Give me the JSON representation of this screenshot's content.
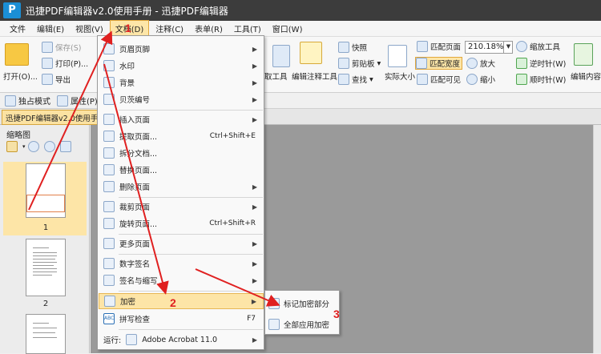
{
  "app": {
    "logo": "P",
    "title": "迅捷PDF编辑器v2.0使用手册 - 迅捷PDF编辑器"
  },
  "menubar": [
    "文件",
    "编辑(E)",
    "视图(V)",
    "文档(D)",
    "注释(C)",
    "表单(R)",
    "工具(T)",
    "窗口(W)"
  ],
  "ribbon": {
    "open": "打开(O)...",
    "save": "保存(S)",
    "print": "打印(P)...",
    "export": "导出",
    "extract": "取工具",
    "edit_annot": "编辑注释工具",
    "snapshot": "快照",
    "clipboard": "剪贴板",
    "find": "查找",
    "actual_size": "实际大小",
    "fit_page": "匹配页面",
    "fit_width": "匹配宽度",
    "fit_visible": "匹配可见",
    "zoom_value": "210.18%",
    "zoom_in": "放大",
    "zoom_out": "缩小",
    "zoom_tool": "缩放工具",
    "rotate_ccw": "逆时针(W)",
    "rotate_cw": "顺时针(W)",
    "edit_content": "编辑内容"
  },
  "toolbar2": {
    "exclusive_mode": "独占模式",
    "properties": "属性(P)..."
  },
  "doc_tab": "迅捷PDF编辑器v2.0使用手册",
  "sidebar": {
    "title": "缩略图",
    "page1": "1",
    "page2": "2"
  },
  "doc_menu": {
    "items": [
      {
        "label": "页眉页脚",
        "shortcut": "",
        "sub": true
      },
      {
        "label": "水印",
        "shortcut": "",
        "sub": true
      },
      {
        "label": "背景",
        "shortcut": "",
        "sub": true
      },
      {
        "label": "贝茨编号",
        "shortcut": "",
        "sub": true
      },
      {
        "label": "插入页面",
        "shortcut": "",
        "sub": true
      },
      {
        "label": "提取页面...",
        "shortcut": "Ctrl+Shift+E",
        "sub": false
      },
      {
        "label": "拆分文档...",
        "shortcut": "",
        "sub": false
      },
      {
        "label": "替换页面...",
        "shortcut": "",
        "sub": false
      },
      {
        "label": "删除页面",
        "shortcut": "",
        "sub": true
      },
      {
        "label": "裁剪页面",
        "shortcut": "",
        "sub": true
      },
      {
        "label": "旋转页面...",
        "shortcut": "Ctrl+Shift+R",
        "sub": false
      },
      {
        "label": "更多页面",
        "shortcut": "",
        "sub": true
      },
      {
        "label": "数字签名",
        "shortcut": "",
        "sub": true
      },
      {
        "label": "签名与缩写",
        "shortcut": "",
        "sub": true
      },
      {
        "label": "加密",
        "shortcut": "",
        "sub": true
      },
      {
        "label": "拼写检查",
        "shortcut": "F7",
        "sub": false
      },
      {
        "label": "运行:",
        "shortcut": "",
        "sub": true,
        "extra": "Adobe Acrobat 11.0"
      }
    ]
  },
  "encrypt_submenu": [
    "标记加密部分",
    "全部应用加密"
  ],
  "annotations": {
    "step1": "1",
    "step2": "2",
    "step3": "3",
    "color": "#e02020"
  }
}
